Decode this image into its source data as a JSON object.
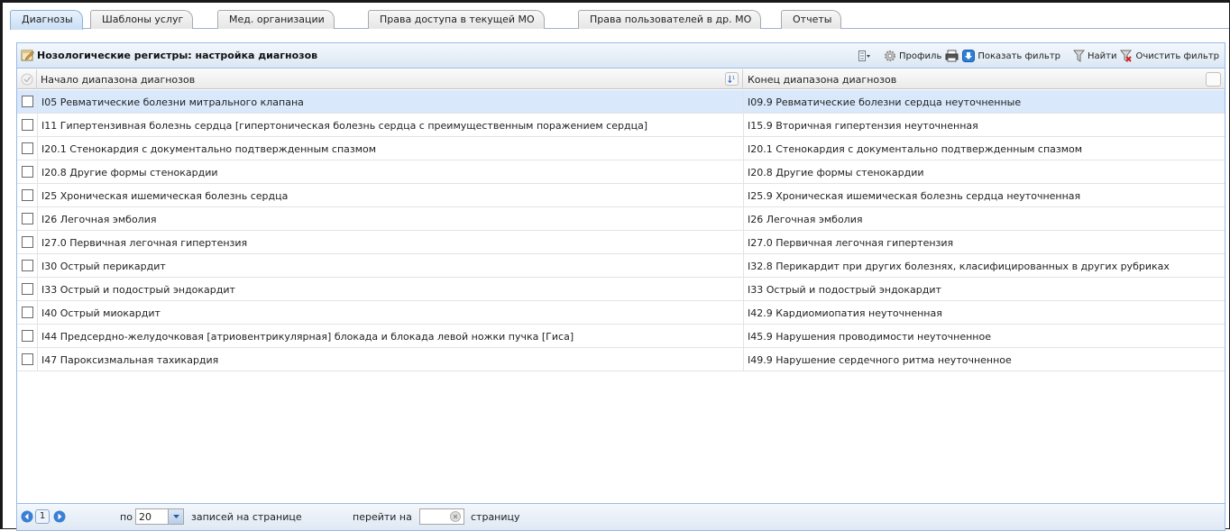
{
  "tabs": [
    {
      "label": "Диагнозы",
      "active": true
    },
    {
      "label": "Шаблоны услуг",
      "active": false
    },
    {
      "label": "Мед. организации",
      "active": false
    },
    {
      "label": "Права доступа в текущей МО",
      "active": false
    },
    {
      "label": "Права пользователей в др. МО",
      "active": false
    },
    {
      "label": "Отчеты",
      "active": false
    }
  ],
  "panel": {
    "title": "Нозологические регистры: настройка диагнозов",
    "toolbar": {
      "profile": "Профиль",
      "show_filter": "Показать фильтр",
      "find": "Найти",
      "clear_filter": "Очистить фильтр"
    }
  },
  "grid": {
    "columns": [
      "Начало диапазона диагнозов",
      "Конец диапазона диагнозов"
    ],
    "rows": [
      {
        "start": "I05 Ревматические болезни митрального клапана",
        "end": "I09.9 Ревматические болезни сердца неуточненные",
        "selected": true
      },
      {
        "start": "I11 Гипертензивная болезнь сердца [гипертоническая болезнь сердца с преимущественным поражением сердца]",
        "end": "I15.9 Вторичная гипертензия неуточненная"
      },
      {
        "start": "I20.1 Стенокардия с документально подтвержденным спазмом",
        "end": "I20.1 Стенокардия с документально подтвержденным спазмом"
      },
      {
        "start": "I20.8 Другие формы стенокардии",
        "end": "I20.8 Другие формы стенокардии"
      },
      {
        "start": "I25 Хроническая ишемическая болезнь сердца",
        "end": "I25.9 Хроническая ишемическая болезнь сердца неуточненная"
      },
      {
        "start": "I26 Легочная эмболия",
        "end": "I26 Легочная эмболия"
      },
      {
        "start": "I27.0 Первичная легочная гипертензия",
        "end": "I27.0 Первичная легочная гипертензия"
      },
      {
        "start": "I30 Острый перикардит",
        "end": "I32.8 Перикардит при других болезнях, класифицированных в других рубриках"
      },
      {
        "start": "I33 Острый и подострый эндокардит",
        "end": "I33 Острый и подострый эндокардит"
      },
      {
        "start": "I40 Острый миокардит",
        "end": "I42.9 Кардиомиопатия неуточненная"
      },
      {
        "start": "I44 Предсердно-желудочковая [атриовентрикулярная] блокада и блокада левой ножки пучка [Гиса]",
        "end": "I45.9 Нарушения проводимости неуточненное"
      },
      {
        "start": "I47 Пароксизмальная тахикардия",
        "end": "I49.9 Нарушение сердечного ритма неуточненное"
      }
    ]
  },
  "pager": {
    "page": "1",
    "per_prefix": "по",
    "per_page": "20",
    "per_suffix": "записей на странице",
    "goto_prefix": "перейти на",
    "goto_value": "",
    "goto_suffix": "страницу"
  },
  "colors": {
    "accent": "#99bbe8",
    "selected_row": "#d9e8fb"
  }
}
